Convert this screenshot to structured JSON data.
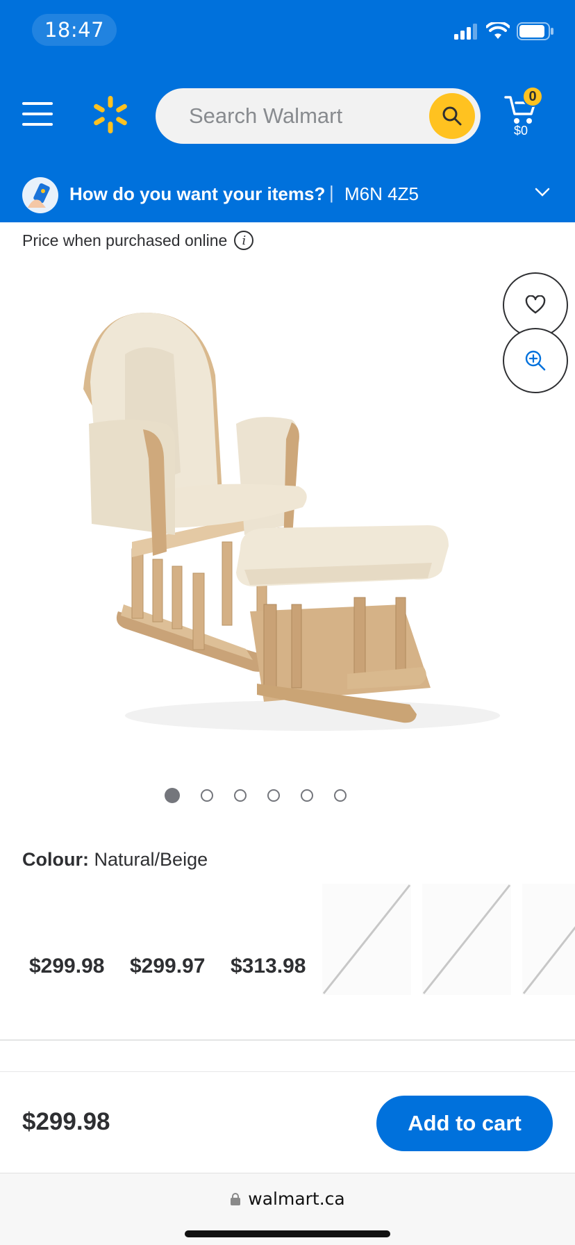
{
  "status_bar": {
    "time": "18:47"
  },
  "header": {
    "search_placeholder": "Search Walmart",
    "cart_count": "0",
    "cart_total": "$0"
  },
  "fulfillment": {
    "question": "How do you want your items?",
    "separator": "|",
    "postal_code": "M6N 4Z5"
  },
  "product": {
    "price_note": "Price when purchased online",
    "image_count": 6,
    "active_image_index": 0,
    "colour_label": "Colour:",
    "colour_value": "Natural/Beige",
    "variants": [
      {
        "price": "$299.98"
      },
      {
        "price": "$299.97"
      },
      {
        "price": "$313.98"
      }
    ]
  },
  "sticky_bar": {
    "price": "$299.98",
    "add_to_cart": "Add to cart"
  },
  "browser": {
    "url": "walmart.ca"
  },
  "colors": {
    "brand_blue": "#0071dc",
    "spark_yellow": "#ffc220"
  }
}
